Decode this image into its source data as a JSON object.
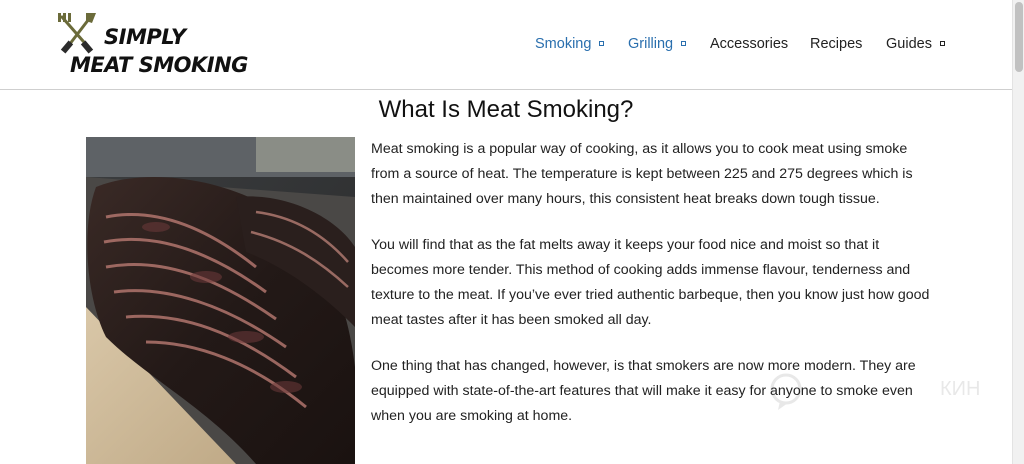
{
  "logo": {
    "line1": "SIMPLY",
    "line2": "MEAT SMOKING",
    "icon": "crossed-fork-and-knife-icon"
  },
  "nav": {
    "items": [
      {
        "label": "Smoking",
        "has_dropdown": true,
        "color": "#2a6fae"
      },
      {
        "label": "Grilling",
        "has_dropdown": true,
        "color": "#2a6fae"
      },
      {
        "label": "Accessories",
        "has_dropdown": false,
        "color": "#222222"
      },
      {
        "label": "Recipes",
        "has_dropdown": false,
        "color": "#222222"
      },
      {
        "label": "Guides",
        "has_dropdown": true,
        "color": "#222222"
      }
    ]
  },
  "main": {
    "title": "What Is Meat Smoking?",
    "image": "smoked-ribs-photo",
    "paragraphs": [
      "Meat smoking is a popular way of cooking, as it allows you to cook meat using smoke from a source of heat. The temperature is kept between 225 and 275 degrees which is then maintained over many hours, this consistent heat breaks down tough tissue.",
      "You will find that as the fat melts away it keeps your food nice and moist so that it becomes more tender. This method of cooking adds immense flavour, tenderness and texture to the meat. If you’ve ever tried authentic barbeque, then you know just how good meat tastes after it has been smoked all day.",
      "One thing that has changed, however, is that smokers are now more modern. They are equipped with state-of-the-art features that will make it easy for anyone to smoke even when you are smoking at home."
    ]
  },
  "watermark": {
    "text": "КИН"
  }
}
